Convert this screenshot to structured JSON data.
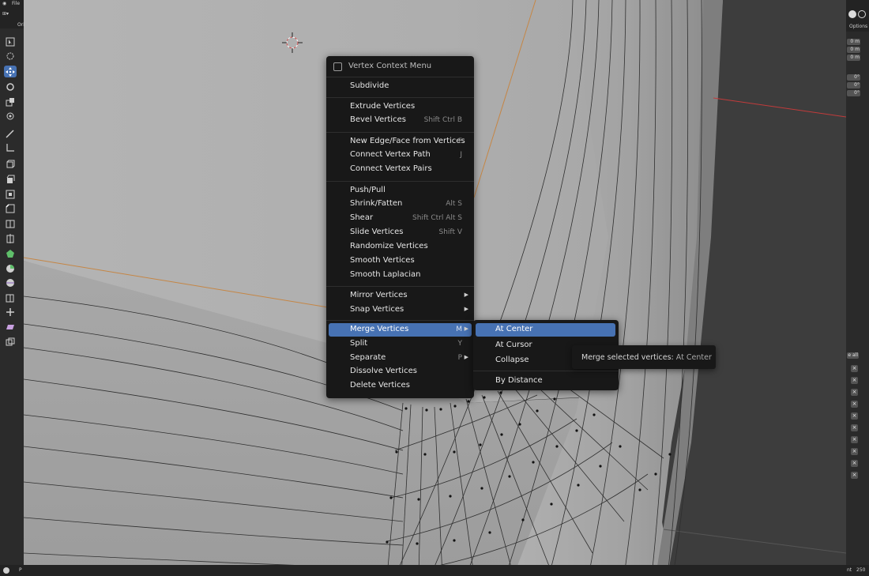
{
  "app": {
    "file_menu": "File",
    "header_hint": "Ori"
  },
  "right_panel": {
    "options_label": "Options",
    "loc_fields": [
      "0 m",
      "0 m",
      "0 m"
    ],
    "rot_fields": [
      "0°",
      "0°",
      "0°"
    ],
    "merge_all_label": "e all"
  },
  "bottom_bar": {
    "left_text": "P",
    "right_text": "nt",
    "version": "250"
  },
  "context_menu": {
    "title": "Vertex Context Menu",
    "items": [
      {
        "label": "Subdivide",
        "shortcut": ""
      },
      {
        "label": "Extrude Vertices",
        "shortcut": ""
      },
      {
        "label": "Bevel Vertices",
        "shortcut": "Shift Ctrl B"
      },
      {
        "label": "New Edge/Face from Vertices",
        "shortcut": "F"
      },
      {
        "label": "Connect Vertex Path",
        "shortcut": "J"
      },
      {
        "label": "Connect Vertex Pairs",
        "shortcut": ""
      },
      {
        "label": "Push/Pull",
        "shortcut": ""
      },
      {
        "label": "Shrink/Fatten",
        "shortcut": "Alt S"
      },
      {
        "label": "Shear",
        "shortcut": "Shift Ctrl Alt S"
      },
      {
        "label": "Slide Vertices",
        "shortcut": "Shift V"
      },
      {
        "label": "Randomize Vertices",
        "shortcut": ""
      },
      {
        "label": "Smooth Vertices",
        "shortcut": ""
      },
      {
        "label": "Smooth Laplacian",
        "shortcut": ""
      },
      {
        "label": "Mirror Vertices",
        "shortcut": ""
      },
      {
        "label": "Snap Vertices",
        "shortcut": ""
      },
      {
        "label": "Merge Vertices",
        "shortcut": "M"
      },
      {
        "label": "Split",
        "shortcut": "Y"
      },
      {
        "label": "Separate",
        "shortcut": "P"
      },
      {
        "label": "Dissolve Vertices",
        "shortcut": ""
      },
      {
        "label": "Delete Vertices",
        "shortcut": ""
      }
    ]
  },
  "merge_submenu": {
    "items": [
      {
        "label": "At Center"
      },
      {
        "label": "At Cursor"
      },
      {
        "label": "Collapse"
      },
      {
        "label": "By Distance"
      }
    ]
  },
  "tooltip": {
    "text": "Merge selected vertices:",
    "value": "At Center"
  },
  "colors": {
    "accent": "#4772b3",
    "menu_bg": "#181818",
    "viewport": "#9b9b9b"
  },
  "icons": [
    "blender-icon",
    "select-box-icon",
    "cursor-icon",
    "move-icon",
    "rotate-icon",
    "scale-icon",
    "transform-icon",
    "annotate-icon",
    "measure-icon",
    "add-cube-icon",
    "extrude-icon",
    "inset-icon",
    "bevel-icon",
    "loop-cut-icon",
    "knife-icon",
    "poly-build-icon",
    "spin-icon",
    "smooth-icon",
    "edge-slide-icon",
    "shrink-icon",
    "shear-icon",
    "rip-icon"
  ]
}
